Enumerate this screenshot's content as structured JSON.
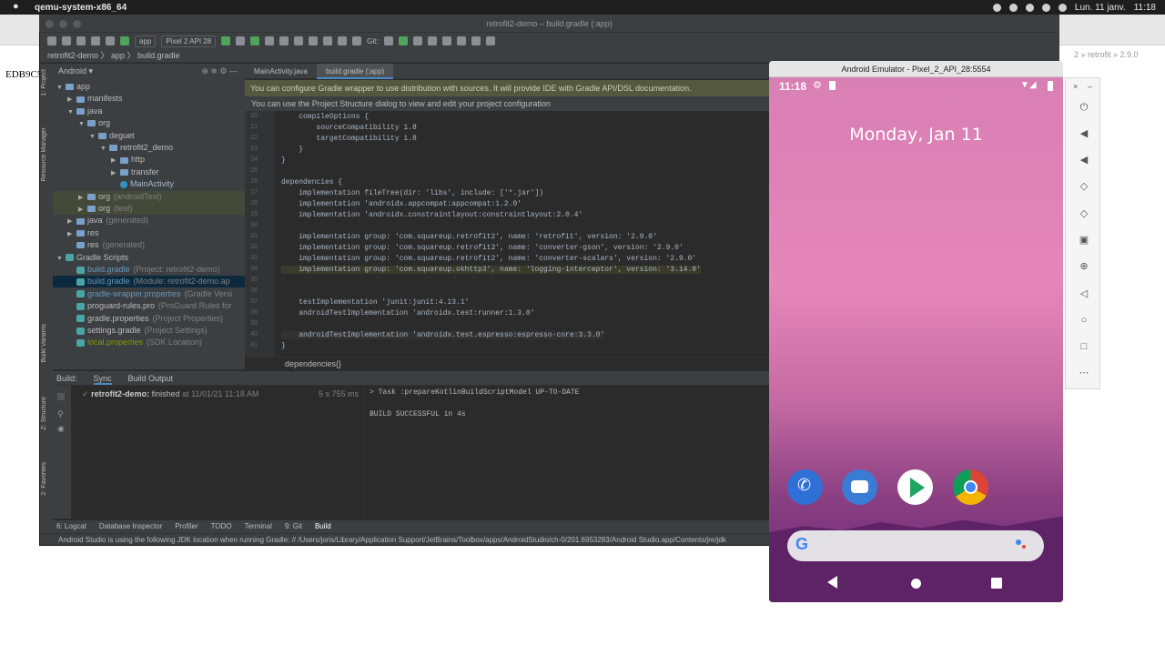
{
  "mac": {
    "app_name": "qemu-system-x86_64",
    "date": "Lun. 11 janv.",
    "time": "11:18"
  },
  "background": {
    "text": "EDB9C5",
    "right_text": "2 » retrofit » 2.9.0"
  },
  "ide": {
    "title": "retrofit2-demo – build.gradle (:app)",
    "toolbar": {
      "config": "app",
      "device": "Pixel 2 API 28",
      "git_label": "Git:"
    },
    "breadcrumb": "retrofit2-demo 〉 app 〉 build.gradle",
    "project_view": "Android",
    "side_tabs": {
      "project": "1: Project",
      "resource_manager": "Resource Manager",
      "build_variants": "Build Variants",
      "structure": "Z: Structure",
      "favorites": "2: Favorites"
    },
    "tree": [
      {
        "label": "app",
        "extra": "",
        "kind": "folder",
        "depth": 0,
        "arrow": "▼"
      },
      {
        "label": "manifests",
        "extra": "",
        "kind": "folder",
        "depth": 1,
        "arrow": "▶"
      },
      {
        "label": "java",
        "extra": "",
        "kind": "folder",
        "depth": 1,
        "arrow": "▼"
      },
      {
        "label": "org",
        "extra": "",
        "kind": "folder",
        "depth": 2,
        "arrow": "▼"
      },
      {
        "label": "deguet",
        "extra": "",
        "kind": "folder",
        "depth": 3,
        "arrow": "▼"
      },
      {
        "label": "retrofit2_demo",
        "extra": "",
        "kind": "folder",
        "depth": 4,
        "arrow": "▼"
      },
      {
        "label": "http",
        "extra": "",
        "kind": "folder",
        "depth": 5,
        "arrow": "▶"
      },
      {
        "label": "transfer",
        "extra": "",
        "kind": "folder",
        "depth": 5,
        "arrow": "▶"
      },
      {
        "label": "MainActivity",
        "extra": "",
        "kind": "class",
        "depth": 5,
        "arrow": ""
      },
      {
        "label": "org",
        "extra": "(androidTest)",
        "kind": "folder",
        "depth": 2,
        "arrow": "▶"
      },
      {
        "label": "org",
        "extra": "(test)",
        "kind": "folder",
        "depth": 2,
        "arrow": "▶"
      },
      {
        "label": "java",
        "extra": "(generated)",
        "kind": "folder",
        "depth": 1,
        "arrow": "▶"
      },
      {
        "label": "res",
        "extra": "",
        "kind": "folder",
        "depth": 1,
        "arrow": "▶"
      },
      {
        "label": "res",
        "extra": "(generated)",
        "kind": "folder",
        "depth": 1,
        "arrow": ""
      },
      {
        "label": "Gradle Scripts",
        "extra": "",
        "kind": "gradle",
        "depth": 0,
        "arrow": "▼"
      },
      {
        "label": "build.gradle",
        "extra": "(Project: retrofit2-demo)",
        "kind": "gradle",
        "depth": 1,
        "arrow": ""
      },
      {
        "label": "build.gradle",
        "extra": "(Module: retrofit2-demo.ap",
        "kind": "gradle",
        "depth": 1,
        "arrow": ""
      },
      {
        "label": "gradle-wrapper.properties",
        "extra": "(Gradle Versi",
        "kind": "gradle",
        "depth": 1,
        "arrow": ""
      },
      {
        "label": "proguard-rules.pro",
        "extra": "(ProGuard Rules for",
        "kind": "gradle",
        "depth": 1,
        "arrow": ""
      },
      {
        "label": "gradle.properties",
        "extra": "(Project Properties)",
        "kind": "gradle",
        "depth": 1,
        "arrow": ""
      },
      {
        "label": "settings.gradle",
        "extra": "(Project Settings)",
        "kind": "gradle",
        "depth": 1,
        "arrow": ""
      },
      {
        "label": "local.properties",
        "extra": "(SDK Location)",
        "kind": "gradle",
        "depth": 1,
        "arrow": ""
      }
    ],
    "tabs": [
      {
        "label": "MainActivity.java",
        "active": false
      },
      {
        "label": "build.gradle (:app)",
        "active": true
      }
    ],
    "banner": "You can configure Gradle wrapper to use distribution with sources. It will provide IDE with Gradle API/DSL documentation.",
    "banner2": "You can use the Project Structure dialog to view and edit your project configuration",
    "code_lines": [
      {
        "n": "20",
        "text": "    compileOptions {"
      },
      {
        "n": "21",
        "text": "        sourceCompatibility 1.8"
      },
      {
        "n": "22",
        "text": "        targetCompatibility 1.8"
      },
      {
        "n": "23",
        "text": "    }"
      },
      {
        "n": "24",
        "text": "}"
      },
      {
        "n": "25",
        "text": ""
      },
      {
        "n": "26",
        "text": "dependencies {"
      },
      {
        "n": "27",
        "text": "    implementation fileTree(dir: 'libs', include: ['*.jar'])"
      },
      {
        "n": "28",
        "text": "    implementation 'androidx.appcompat:appcompat:1.2.0'"
      },
      {
        "n": "29",
        "text": "    implementation 'androidx.constraintlayout:constraintlayout:2.0.4'"
      },
      {
        "n": "30",
        "text": ""
      },
      {
        "n": "31",
        "text": "    implementation group: 'com.squareup.retrofit2', name: 'retrofit', version: '2.9.0'"
      },
      {
        "n": "32",
        "text": "    implementation group: 'com.squareup.retrofit2', name: 'converter-gson', version: '2.9.0'"
      },
      {
        "n": "33",
        "text": "    implementation group: 'com.squareup.retrofit2', name: 'converter-scalars', version: '2.9.0'"
      },
      {
        "n": "34",
        "text": "    implementation group: 'com.squareup.okhttp3', name: 'logging-interceptor', version: '3.14.9'"
      },
      {
        "n": "35",
        "text": ""
      },
      {
        "n": "36",
        "text": ""
      },
      {
        "n": "37",
        "text": "    testImplementation 'junit:junit:4.13.1'"
      },
      {
        "n": "38",
        "text": "    androidTestImplementation 'androidx.test:runner:1.3.0'"
      },
      {
        "n": "39",
        "text": ""
      },
      {
        "n": "40",
        "text": "    androidTestImplementation 'androidx.test.espresso:espresso-core:3.3.0'"
      },
      {
        "n": "41",
        "text": "}"
      }
    ],
    "editor_breadcrumb": "dependencies{}",
    "build": {
      "tab_build": "Build:",
      "tab_sync": "Sync",
      "tab_output": "Build Output",
      "task_name": "retrofit2-demo:",
      "task_status": "finished",
      "task_time": "at 11/01/21 11:18 AM",
      "duration": "5 s 755 ms",
      "output_line1": "> Task :prepareKotlinBuildScriptModel UP-TO-DATE",
      "output_line2": "BUILD SUCCESSFUL in 4s"
    },
    "bottom_tabs": [
      "6: Logcat",
      "Database Inspector",
      "Profiler",
      "TODO",
      "Terminal",
      "9: Git",
      "Build"
    ],
    "status": "Android Studio is using the following JDK location when running Gradle: // /Users/joris/Library/Application Support/JetBrains/Toolbox/apps/AndroidStudio/ch-0/201.6953283/Android Studio.app/Contents/jre/jdk"
  },
  "emulator": {
    "title": "Android Emulator - Pixel_2_API_28:5554",
    "time": "11:18",
    "date": "Monday, Jan 11"
  }
}
